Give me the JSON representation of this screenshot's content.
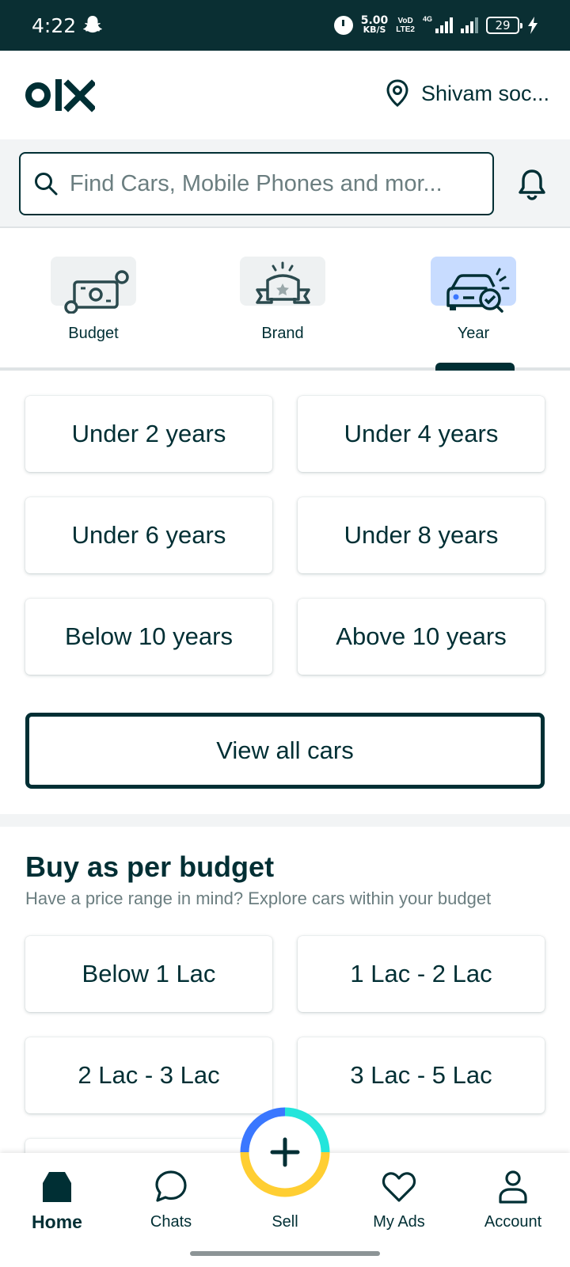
{
  "status_bar": {
    "time": "4:22",
    "speed_value": "5.00",
    "speed_unit": "KB/S",
    "volte_top": "VoD",
    "volte_bottom": "LTE2",
    "network": "4G",
    "battery": "29"
  },
  "header": {
    "location": "Shivam soc..."
  },
  "search": {
    "placeholder": "Find Cars, Mobile Phones and mor..."
  },
  "filter_tabs": [
    {
      "label": "Budget",
      "icon": "money-icon",
      "active": false
    },
    {
      "label": "Brand",
      "icon": "brand-badge-icon",
      "active": false
    },
    {
      "label": "Year",
      "icon": "car-year-icon",
      "active": true
    }
  ],
  "year_options": [
    "Under 2 years",
    "Under 4 years",
    "Under 6 years",
    "Under 8 years",
    "Below 10 years",
    "Above 10 years"
  ],
  "view_all_label": "View all cars",
  "budget_section": {
    "title": "Buy as per budget",
    "subtitle": "Have a price range in mind? Explore cars within your budget",
    "options": [
      "Below 1 Lac",
      "1 Lac - 2 Lac",
      "2 Lac - 3 Lac",
      "3 Lac - 5 Lac"
    ]
  },
  "bottom_nav": [
    {
      "label": "Home",
      "icon": "home-icon",
      "active": true
    },
    {
      "label": "Chats",
      "icon": "chat-icon",
      "active": false
    },
    {
      "label": "Sell",
      "icon": "plus-icon",
      "active": false
    },
    {
      "label": "My Ads",
      "icon": "heart-icon",
      "active": false
    },
    {
      "label": "Account",
      "icon": "person-icon",
      "active": false
    }
  ],
  "colors": {
    "primary": "#002f34",
    "status_bar": "#0a2f33",
    "active_tab_tile": "#c8dcff",
    "sell_ring_blue": "#3a77ff",
    "sell_ring_cyan": "#23e5db",
    "sell_ring_yellow": "#ffce32"
  }
}
